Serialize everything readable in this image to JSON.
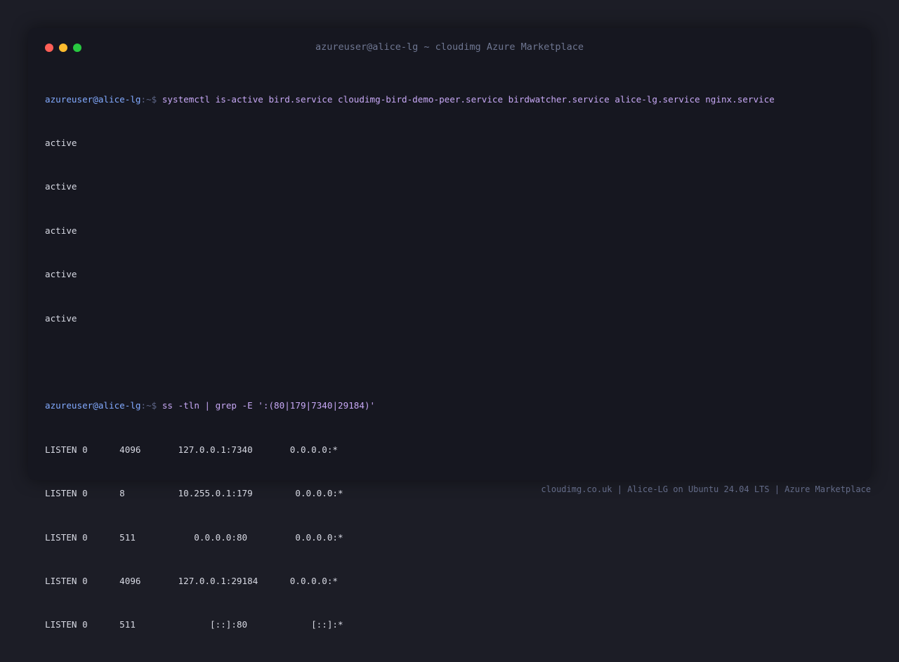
{
  "window": {
    "title": "azureuser@alice-lg ~ cloudimg Azure Marketplace",
    "traffic_lights": [
      {
        "name": "close",
        "color": "#ff5f57"
      },
      {
        "name": "minimize",
        "color": "#febc2e"
      },
      {
        "name": "maximize",
        "color": "#28c840"
      }
    ]
  },
  "colors": {
    "background": "#1c1d26",
    "terminal_bg": "#161720",
    "prompt_user": "#82aaff",
    "prompt_path": "#5c6486",
    "command": "#c7a8f5",
    "output": "#d7d9e3"
  },
  "terminal": {
    "block1": {
      "prompt_user": "azureuser@alice-lg",
      "prompt_path": ":~$ ",
      "command": "systemctl is-active bird.service cloudimg-bird-demo-peer.service birdwatcher.service alice-lg.service nginx.service",
      "output": [
        "active",
        "active",
        "active",
        "active",
        "active"
      ]
    },
    "block2": {
      "prompt_user": "azureuser@alice-lg",
      "prompt_path": ":~$ ",
      "command": "ss -tln | grep -E ':(80|179|7340|29184)'",
      "output": [
        "LISTEN 0      4096       127.0.0.1:7340       0.0.0.0:*",
        "LISTEN 0      8          10.255.0.1:179        0.0.0.0:*",
        "LISTEN 0      511           0.0.0.0:80         0.0.0.0:*",
        "LISTEN 0      4096       127.0.0.1:29184      0.0.0.0:*",
        "LISTEN 0      511              [::]:80            [::]:*"
      ]
    }
  },
  "footer": {
    "text": "cloudimg.co.uk | Alice-LG on Ubuntu 24.04 LTS | Azure Marketplace"
  }
}
